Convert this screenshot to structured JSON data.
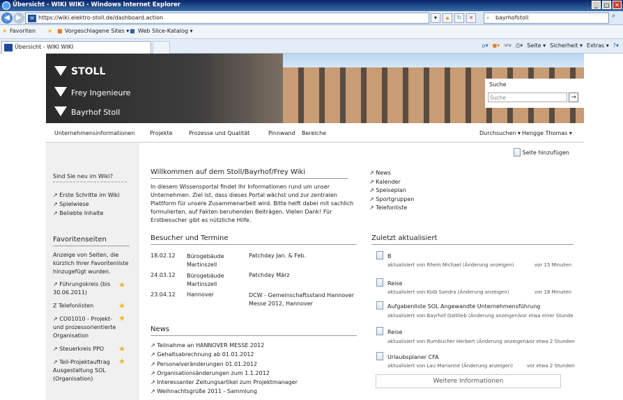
{
  "browser": {
    "title": "Übersicht - WIKI WIKI - Windows Internet Explorer",
    "url": "https://wiki.elektro-stoll.de/dashboard.action",
    "search_value": "bayrhofstoll",
    "favorites_label": "Favoriten",
    "suggested_sites": "Vorgeschlagene Sites ▾",
    "web_slice": "Web Slice-Katalog ▾",
    "tab_title": "Übersicht - WIKI WIKI",
    "cmd_page": "Seite ▾",
    "cmd_security": "Sicherheit ▾",
    "cmd_extras": "Extras ▾"
  },
  "banner": {
    "logo1": "STOLL",
    "logo2": "Frey Ingenieure",
    "logo3": "Bayrhof Stoll",
    "search_label": "Suche",
    "search_placeholder": "Suche"
  },
  "nav": {
    "items": [
      "Unternehmensinformationen",
      "Projekte",
      "Prozesse und Qualität",
      "Pinnwand",
      "Bereiche"
    ],
    "browse": "Durchsuchen ▾",
    "user": "Hengge Thomas ▾"
  },
  "left": {
    "new_heading": "Sind Sie neu im Wiki?",
    "links": [
      "Erste Schritte im Wiki",
      "Spielwiese",
      "Beliebte Inhalte"
    ],
    "fav_heading": "Favoritenseiten",
    "fav_desc": "Anzeige von Seiten, die kürzlich Ihrer Favoritenliste hinzugefügt wurden.",
    "favorites": [
      "Führungskreis (bis 30.06.2011)",
      "Telefonlisten",
      "CO01010 - Projekt- und prozessorientierte Organisation",
      "Steuerkreis PPO",
      "Teil-Projektauftrag Ausgestaltung SOL (Organisation)"
    ]
  },
  "content": {
    "add_page": "Seite hinzufügen",
    "welcome_title": "Willkommen auf dem Stoll/Bayrhof/Frey Wiki",
    "welcome_text": "In diesem Wissensportal findet Ihr Informationen rund um unser Unternehmen. Ziel ist, dass dieses Portal wächst und zur zentralen Plattform für unsere Zusammenarbeit wird. Bitte helft dabei mit sachlich formulierten, auf Fakten beruhenden Beiträgen. Vielen Dank! Für Erstbesucher gibt es nützliche Hilfe.",
    "quicklinks": [
      "News",
      "Kalender",
      "Speiseplan",
      "Sportgruppen",
      "Telefonliste"
    ],
    "visitors_title": "Besucher und Termine",
    "visitors": [
      {
        "date": "18.02.12",
        "place": "Bürogebäude Martinszell",
        "event": "Patchday Jan. & Feb."
      },
      {
        "date": "24.03.12",
        "place": "Bürogebäude Martinszell",
        "event": "Patchday März"
      },
      {
        "date": "23.04.12",
        "place": "Hannover",
        "event": "DCW - Gemeinschaftsstand Hannover Messe 2012, Hannover"
      }
    ],
    "news_title": "News",
    "news": [
      "Teilnahme an HANNOVER MESSE 2012",
      "Gehaltsabrechnung ab 01.01.2012",
      "Personalveränderungen 01.01.2012",
      "Organisationsänderungen zum 1.1.2012",
      "Interessanter Zeitungsartikel zum Projektmanager",
      "Weihnachtsgrüße 2011 - Sammlung"
    ],
    "recent_title": "Zuletzt aktualisiert",
    "recent": [
      {
        "title": "B",
        "by": "aktualisiert von Rhein Michael (Änderung anzeigen)",
        "when": "vor 15 Minuten"
      },
      {
        "title": "Reise",
        "by": "aktualisiert von Kolb Sandra (Änderung anzeigen)",
        "when": "vor 18 Minuten"
      },
      {
        "title": "Aufgabenliste SOL Angewandte Unternehmensführung",
        "by": "aktualisiert von Bayrhof Gottlieb (Änderung anzeigen)",
        "when": "vor etwa einer Stunde"
      },
      {
        "title": "Reise",
        "by": "aktualisiert von Rumbucher Herbert (Änderung anzeigen)",
        "when": "vor etwa 2 Stunden"
      },
      {
        "title": "Urlaubsplaner CFA",
        "by": "aktualisiert von Lau Marianne (Änderung anzeigen)",
        "when": "vor etwa 2 Stunden"
      }
    ],
    "more_info": "Weitere Informationen"
  }
}
